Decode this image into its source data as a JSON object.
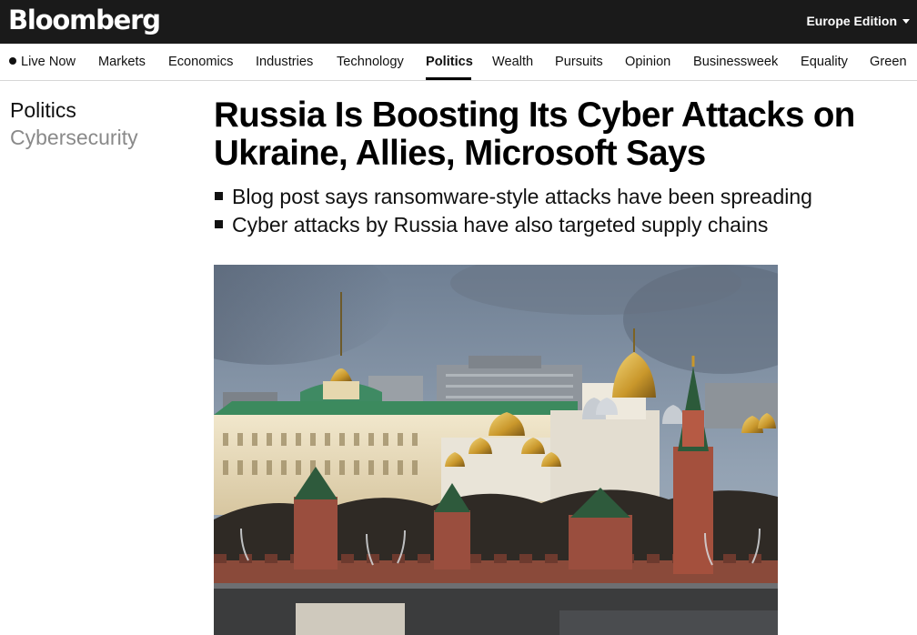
{
  "brand": {
    "logo_text": "Bloomberg"
  },
  "header": {
    "edition_label": "Europe Edition",
    "edition_icon": "chevron-down-icon"
  },
  "nav": {
    "items": [
      {
        "label": "Live Now"
      },
      {
        "label": "Markets"
      },
      {
        "label": "Economics"
      },
      {
        "label": "Industries"
      },
      {
        "label": "Technology"
      },
      {
        "label": "Politics",
        "active": true
      },
      {
        "label": "Wealth"
      },
      {
        "label": "Pursuits"
      },
      {
        "label": "Opinion"
      },
      {
        "label": "Businessweek"
      },
      {
        "label": "Equality"
      },
      {
        "label": "Green"
      }
    ]
  },
  "article": {
    "section": "Politics",
    "subsection": "Cybersecurity",
    "headline": "Russia Is Boosting Its Cyber Attacks on Ukraine, Allies, Microsoft Says",
    "bullets": [
      "Blog post says ransomware-style attacks have been spreading",
      "Cyber attacks by Russia have also targeted supply chains"
    ],
    "image_subject": "kremlin-photo"
  },
  "colors": {
    "topbar_bg": "#1a1a1a",
    "subsection_text": "#8a8a8a",
    "divider": "#d6d6d6"
  }
}
